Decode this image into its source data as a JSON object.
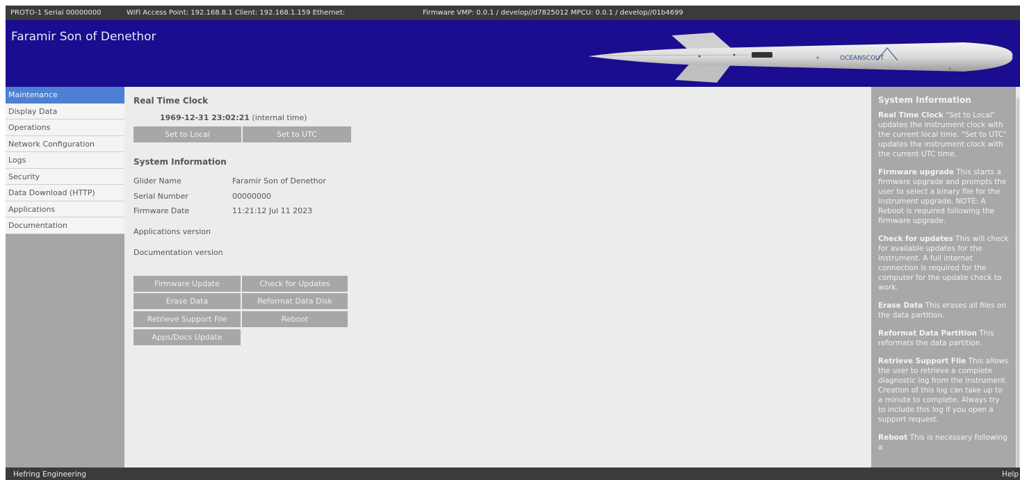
{
  "topbar": {
    "device": "PROTO-1 Serial 00000000",
    "network": "WiFi Access Point: 192.168.8.1 Client: 192.168.1.159 Ethernet:",
    "firmware": "Firmware VMP: 0.0.1 / develop//d7825012 MPCU: 0.0.1 / develop//01b4699"
  },
  "header": {
    "title": "Faramir Son of Denethor",
    "brand_text": "OCEANSCOUT"
  },
  "sidebar": {
    "items": [
      {
        "label": "Maintenance"
      },
      {
        "label": "Display Data"
      },
      {
        "label": "Operations"
      },
      {
        "label": "Network Configuration"
      },
      {
        "label": "Logs"
      },
      {
        "label": "Security"
      },
      {
        "label": "Data Download (HTTP)"
      },
      {
        "label": "Applications"
      },
      {
        "label": "Documentation"
      }
    ]
  },
  "main": {
    "rtc_title": "Real Time Clock",
    "clock_value": "1969-12-31 23:02:21",
    "clock_note": "(internal time)",
    "set_local": "Set to Local",
    "set_utc": "Set to UTC",
    "sysinfo_title": "System Information",
    "glider_name_label": "Glider Name",
    "glider_name_value": "Faramir Son of Denethor",
    "serial_label": "Serial Number",
    "serial_value": "00000000",
    "fw_date_label": "Firmware Date",
    "fw_date_value": "11:21:12 Jul 11 2023",
    "apps_version_label": "Applications version",
    "docs_version_label": "Documentation version",
    "buttons": {
      "firmware_update": "Firmware Update",
      "check_updates": "Check for Updates",
      "erase_data": "Erase Data",
      "reformat": "Reformat Data Disk",
      "retrieve_support": "Retrieve Support File",
      "reboot": "Reboot",
      "apps_docs_update": "Apps/Docs Update"
    }
  },
  "help": {
    "title": "System Information",
    "items": [
      {
        "term": "Real Time Clock",
        "text": " \"Set to Local\" updates the instrument clock with the current local time. \"Set to UTC\" updates the instrument clock with the current UTC time."
      },
      {
        "term": "Firmware upgrade",
        "text": " This starts a firmware upgrade and prompts the user to select a binary file for the instrument upgrade. NOTE: A Reboot is required following the firmware upgrade."
      },
      {
        "term": "Check for updates",
        "text": " This will check for available updates for the instrument. A full internet connection is required for the computer for the update check to work."
      },
      {
        "term": "Erase Data",
        "text": " This erases all files on the data partition."
      },
      {
        "term": "Reformat Data Partition",
        "text": " This reformats the data partition."
      },
      {
        "term": "Retrieve Support File",
        "text": " This allows the user to retrieve a complete diagnostic log from the instrument. Creation of this log can take up to a minute to complete. Always try to include this log if you open a support request."
      },
      {
        "term": "Reboot",
        "text": " This is necessary following a"
      }
    ]
  },
  "footer": {
    "company": "Hefring Engineering",
    "help": "Help"
  },
  "colors": {
    "header_bg": "#1a0d8f",
    "active_nav": "#4d80d2",
    "bars": "#3b3b3b",
    "button": "#a7a7a7"
  }
}
